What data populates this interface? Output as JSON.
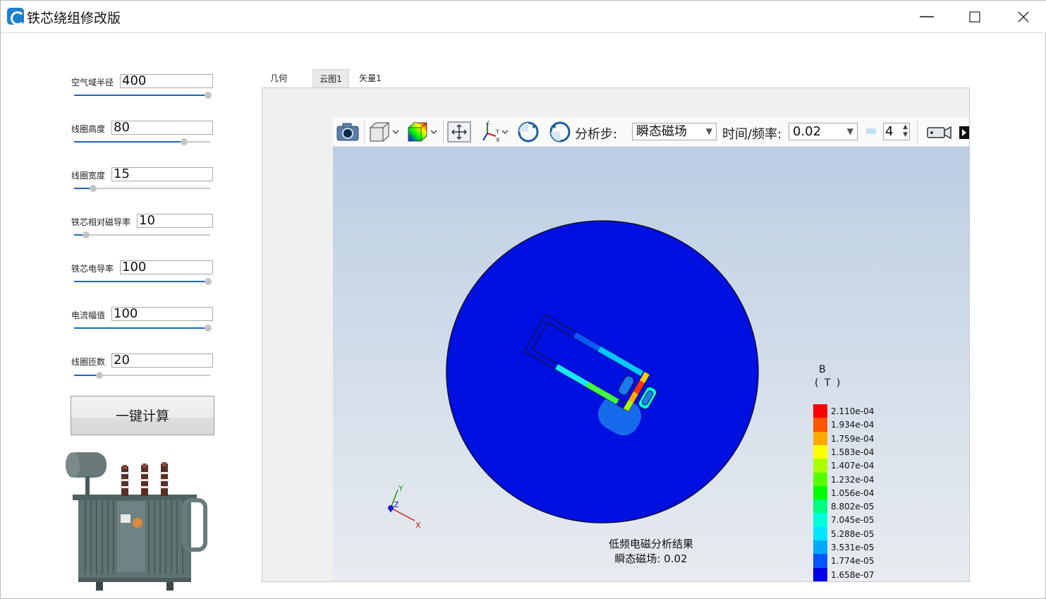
{
  "window": {
    "title": "铁芯绕组修改版",
    "minimize_glyph": "—",
    "maximize_glyph": "☐",
    "close_glyph": "✕"
  },
  "params": [
    {
      "label": "空气域半径",
      "value": "400",
      "slider_level": 1.0
    },
    {
      "label": "线圈高度",
      "value": "80",
      "slider_level": 0.82
    },
    {
      "label": "线圈宽度",
      "value": "15",
      "slider_level": 0.14
    },
    {
      "label": "铁芯相对磁导率",
      "value": "10",
      "slider_level": 0.09
    },
    {
      "label": "铁芯电导率",
      "value": "100",
      "slider_level": 1.0
    },
    {
      "label": "电流幅值",
      "value": "100",
      "slider_level": 1.0
    },
    {
      "label": "线圈匝数",
      "value": "20",
      "slider_level": 0.19
    }
  ],
  "calc_button": "一键计算",
  "tabs": [
    {
      "label": "几何"
    },
    {
      "label": "云图1"
    },
    {
      "label": "矢量1"
    }
  ],
  "toolbar": {
    "step_label": "分析步:",
    "step_value": "瞬态磁场",
    "time_label": "时间/频率:",
    "time_value": "0.02",
    "frame_value": "4",
    "icons": [
      "camera-icon",
      "view-cube-icon",
      "color-map-icon",
      "fit-view-icon",
      "axes-icon",
      "rotate-ccw-icon",
      "rotate-cw-icon",
      "video-icon",
      "play-icon"
    ]
  },
  "legend": {
    "quantity": "B",
    "unit": "( T )",
    "entries": [
      {
        "label": "2.110e-04",
        "color": "#ff0000"
      },
      {
        "label": "1.934e-04",
        "color": "#ff5500"
      },
      {
        "label": "1.759e-04",
        "color": "#ffaa00"
      },
      {
        "label": "1.583e-04",
        "color": "#ffff00"
      },
      {
        "label": "1.407e-04",
        "color": "#aaff00"
      },
      {
        "label": "1.232e-04",
        "color": "#55ff00"
      },
      {
        "label": "1.056e-04",
        "color": "#00ff00"
      },
      {
        "label": "8.802e-05",
        "color": "#00ff80"
      },
      {
        "label": "7.045e-05",
        "color": "#00ffdd"
      },
      {
        "label": "5.288e-05",
        "color": "#00e6ff"
      },
      {
        "label": "3.531e-05",
        "color": "#00aaff"
      },
      {
        "label": "1.774e-05",
        "color": "#0055ff"
      },
      {
        "label": "1.658e-07",
        "color": "#0000e6"
      }
    ]
  },
  "axes": {
    "x": "X",
    "y": "Y",
    "z": "Z"
  },
  "result": {
    "line1": "低频电磁分析结果",
    "line2": "瞬态磁场: 0.02"
  },
  "colors": {
    "field_blue": "#0010e0",
    "slider_fill": "#1b66bd"
  }
}
